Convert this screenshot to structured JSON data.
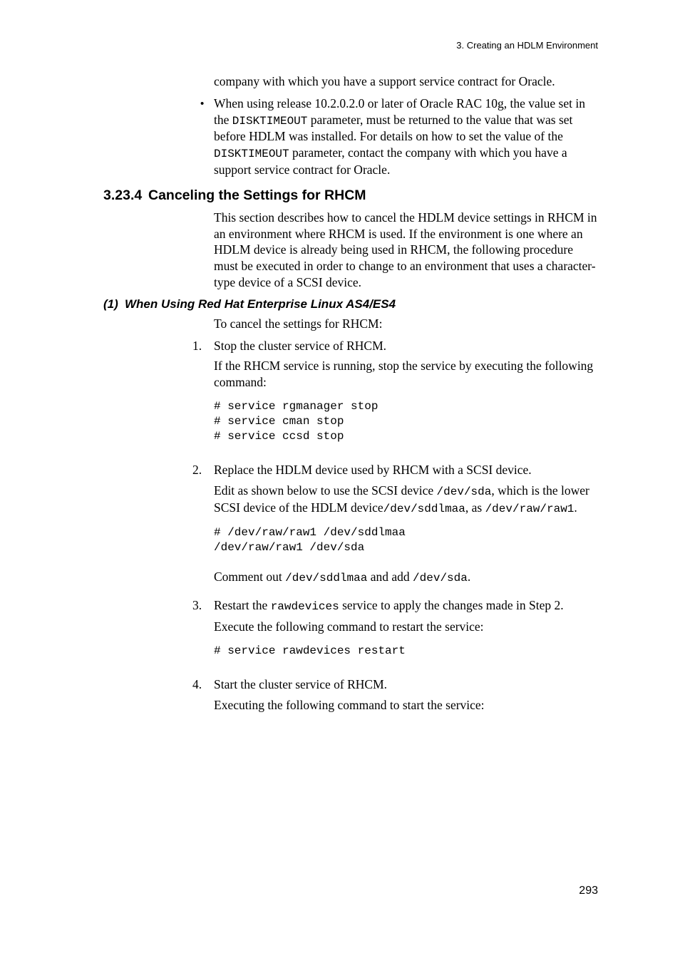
{
  "header": {
    "breadcrumb": "3.  Creating an HDLM Environment"
  },
  "intro": {
    "line1": "company with which you have a support service contract for Oracle.",
    "bullet_pre": "When using release 10.2.0.2.0 or later of Oracle RAC 10g, the value set in the ",
    "bullet_code1": "DISKTIMEOUT",
    "bullet_mid": " parameter, must be returned to the value that was set before HDLM was installed. For details on how to set the value of the ",
    "bullet_code2": "DISKTIMEOUT",
    "bullet_post": " parameter, contact the company with which you have a support service contract for Oracle."
  },
  "h2": {
    "num": "3.23.4",
    "title": "Canceling the Settings for RHCM"
  },
  "section_intro": "This section describes how to cancel the HDLM device settings in RHCM in an environment where RHCM is used. If the environment is one where an HDLM device is already being used in RHCM, the following procedure must be executed in order to change to an environment that uses a character-type device of a SCSI device.",
  "h3": {
    "num": "(1)",
    "title": "When Using Red Hat Enterprise Linux AS4/ES4"
  },
  "h3_intro": "To cancel the settings for RHCM:",
  "steps": {
    "s1": {
      "num": "1.",
      "title": "Stop the cluster service of RHCM.",
      "desc": "If the RHCM service is running, stop the service by executing the following command:",
      "code": "# service rgmanager stop\n# service cman stop\n# service ccsd stop"
    },
    "s2": {
      "num": "2.",
      "title": "Replace the HDLM device used by RHCM with a SCSI device.",
      "desc_pre": "Edit as shown below to use the SCSI device ",
      "desc_c1": "/dev/sda",
      "desc_mid1": ", which is the lower SCSI device of the HDLM device",
      "desc_c2": "/dev/sddlmaa",
      "desc_mid2": ", as ",
      "desc_c3": "/dev/raw/raw1",
      "desc_post": ".",
      "code": "# /dev/raw/raw1 /dev/sddlmaa\n/dev/raw/raw1 /dev/sda",
      "note_pre": "Comment out ",
      "note_c1": "/dev/sddlmaa",
      "note_mid": " and add ",
      "note_c2": "/dev/sda",
      "note_post": "."
    },
    "s3": {
      "num": "3.",
      "title_pre": "Restart the ",
      "title_c1": "rawdevices",
      "title_post": " service to apply the changes made in Step 2.",
      "desc": "Execute the following command to restart the service:",
      "code": "# service rawdevices restart"
    },
    "s4": {
      "num": "4.",
      "title": "Start the cluster service of RHCM.",
      "desc": "Executing the following command to start the service:"
    }
  },
  "page_number": "293"
}
